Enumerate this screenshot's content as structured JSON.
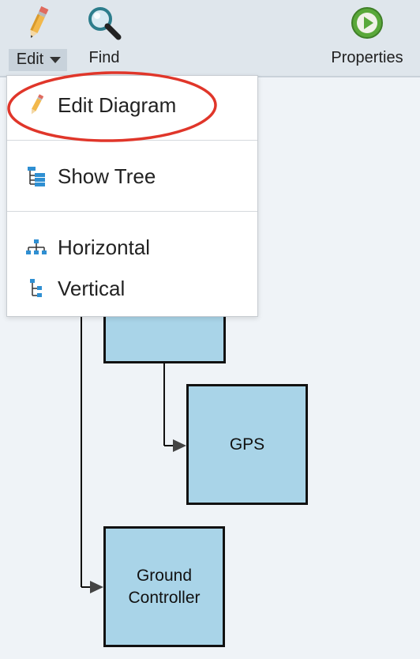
{
  "toolbar": {
    "edit_label": "Edit",
    "find_label": "Find",
    "properties_label": "Properties"
  },
  "menu": {
    "items": [
      {
        "label": "Edit Diagram",
        "icon": "pencil-icon"
      },
      {
        "label": "Show Tree",
        "icon": "tree-icon"
      },
      {
        "label": "Horizontal",
        "icon": "horizontal-layout-icon"
      },
      {
        "label": "Vertical",
        "icon": "vertical-layout-icon"
      }
    ]
  },
  "diagram": {
    "nodes": [
      {
        "label": ""
      },
      {
        "label": "GPS"
      },
      {
        "label": "Ground\nController"
      }
    ]
  },
  "colors": {
    "toolbar_bg": "#dfe6ec",
    "node_fill": "#a9d4e8",
    "highlight_ring": "#e0362a",
    "canvas_bg": "#eff3f7"
  }
}
